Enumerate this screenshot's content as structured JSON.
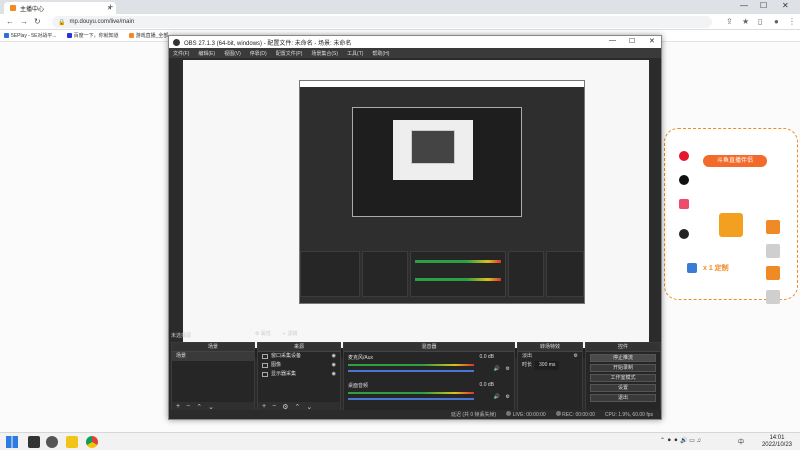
{
  "browser": {
    "tab_title": "主播中心",
    "url": "mp.douyu.com/live/main",
    "bookmarks": [
      {
        "label": "5EPlay - 5E对战平...",
        "color": "#2c6fd6"
      },
      {
        "label": "百度一下，你就知道",
        "color": "#2932e1"
      },
      {
        "label": "游戏直播_全部...",
        "color": "#f08a24"
      }
    ]
  },
  "obs": {
    "title": "OBS 27.1.3 (64-bit, windows) - 配置文件: 未命名 - 场景: 未命名",
    "menu": [
      "文件(F)",
      "编辑(E)",
      "视图(V)",
      "停靠(D)",
      "配置文件(P)",
      "场景集合(S)",
      "工具(T)",
      "帮助(H)"
    ],
    "no_source_selected": "未选择源",
    "filter_tabs": [
      "属性",
      "滤镜"
    ],
    "docks": {
      "scenes": {
        "header": "场景",
        "items": [
          "场景"
        ]
      },
      "sources": {
        "header": "来源",
        "items": [
          "窗口采集设备",
          "图像",
          "显示器采集"
        ]
      },
      "mixer": {
        "header": "混音器",
        "channels": [
          {
            "name": "麦克风/Aux",
            "value": "0.0 dB"
          },
          {
            "name": "桌面音频",
            "value": "0.0 dB"
          }
        ]
      },
      "transitions": {
        "header": "转场特效",
        "type": "淡出",
        "duration_label": "时长",
        "duration": "300 ms"
      },
      "controls": {
        "header": "控件",
        "buttons": [
          "停止推流",
          "开始录制",
          "工作室模式",
          "设置",
          "退出"
        ]
      }
    },
    "status": {
      "live_label": "LIVE:",
      "live_time": "00:00:00",
      "rec_label": "REC:",
      "rec_time": "00:00:00",
      "cpu": "CPU: 1.9%, 60.00 fps",
      "dropped": "延迟 (共 0 帧丢失帧)"
    }
  },
  "overlay": {
    "banner": "斗鱼直播伴侣",
    "fans_line": "x 1 定制"
  },
  "taskbar": {
    "time": "14:01",
    "date": "2022/10/23",
    "lang": "中"
  }
}
